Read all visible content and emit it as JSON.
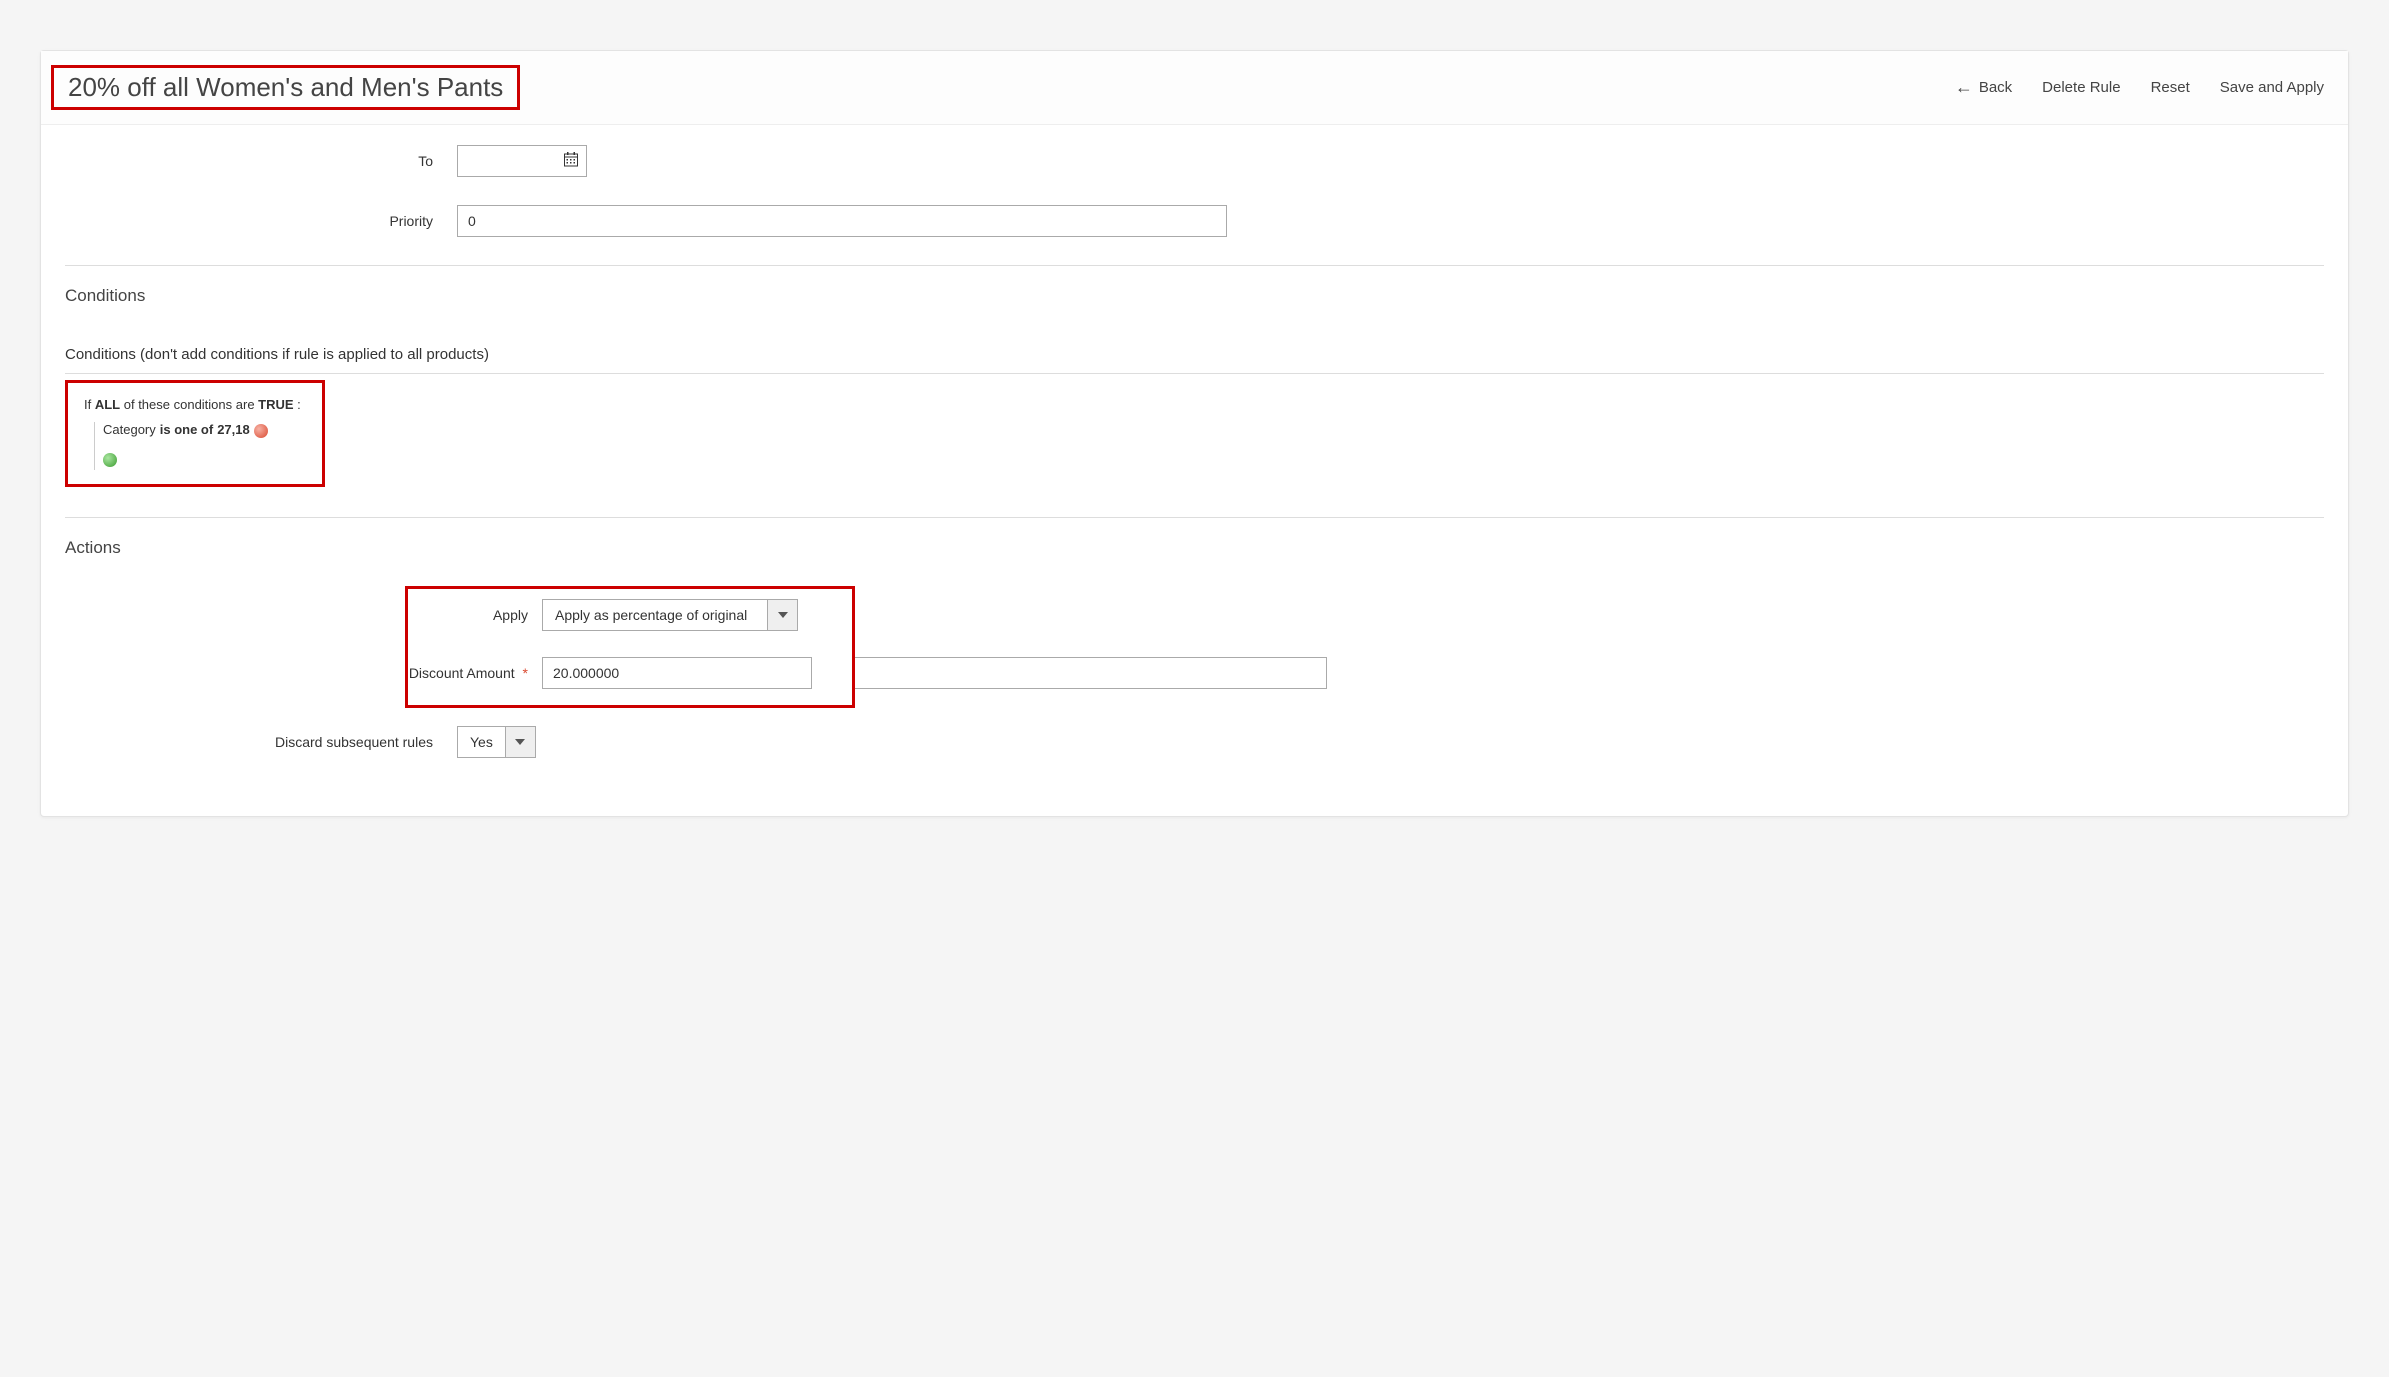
{
  "header": {
    "title": "20% off all Women's and Men's Pants",
    "back_label": "Back",
    "delete_label": "Delete Rule",
    "reset_label": "Reset",
    "save_label": "Save and Apply"
  },
  "form": {
    "to_label": "To",
    "to_value": "",
    "priority_label": "Priority",
    "priority_value": "0"
  },
  "conditions": {
    "section_title": "Conditions",
    "subsection": "Conditions (don't add conditions if rule is applied to all products)",
    "if_prefix": "If ",
    "all_word": "ALL",
    "if_mid": "  of these conditions are ",
    "true_word": "TRUE",
    "if_suffix": " :",
    "attribute": "Category",
    "operator": "  is one of  ",
    "value": "27,18"
  },
  "actions": {
    "section_title": "Actions",
    "apply_label": "Apply",
    "apply_value": "Apply as percentage of original",
    "discount_label": "Discount Amount",
    "discount_value": "20.000000",
    "discard_label": "Discard subsequent rules",
    "discard_value": "Yes"
  }
}
